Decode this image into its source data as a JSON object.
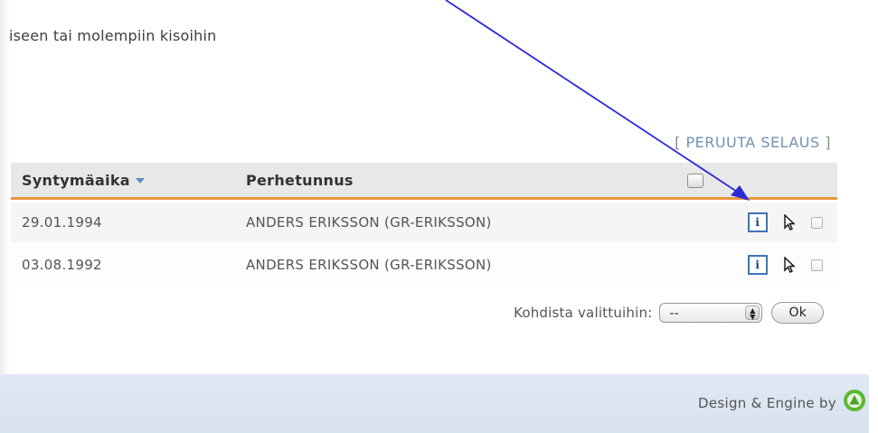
{
  "intro": {
    "text": "iseen tai molempiin kisoihin"
  },
  "browse": {
    "open": "[ ",
    "link": "PERUUTA SELAUS",
    "close": " ]"
  },
  "table": {
    "headers": {
      "birthdate": "Syntymäaika",
      "family": "Perhetunnus"
    },
    "rows": [
      {
        "birthdate": "29.01.1994",
        "family": "ANDERS ERIKSSON (GR-ERIKSSON)",
        "info": "i"
      },
      {
        "birthdate": "03.08.1992",
        "family": "ANDERS ERIKSSON (GR-ERIKSSON)",
        "info": "i"
      }
    ]
  },
  "assign": {
    "label": "Kohdista valittuihin:",
    "selected": "--",
    "ok": "Ok"
  },
  "footer": {
    "credit": "Design & Engine by"
  },
  "colors": {
    "accent": "#e7973c",
    "link": "#6f92b6",
    "arrow": "#2b2bd6",
    "footer": "#dfe8f3"
  },
  "icons": [
    "sort-arrow-icon",
    "info-icon",
    "cursor-icon",
    "checkbox-icon",
    "logo-icon"
  ]
}
